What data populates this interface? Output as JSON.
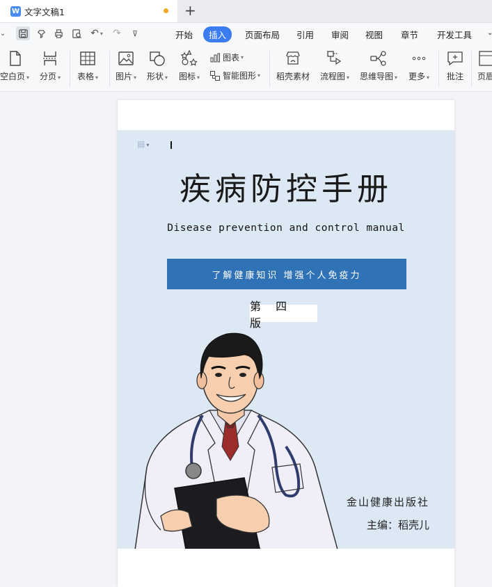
{
  "tab": {
    "title": "文字文稿1"
  },
  "menu": [
    "开始",
    "插入",
    "页面布局",
    "引用",
    "审阅",
    "视图",
    "章节",
    "开发工具"
  ],
  "ribbon": {
    "blank_page": "空白页",
    "page_break": "分页",
    "table": "表格",
    "picture": "图片",
    "shape": "形状",
    "icon": "图标",
    "chart": "图表",
    "smart_art": "智能图形",
    "docer_material": "稻壳素材",
    "flowchart": "流程图",
    "mindmap": "思维导图",
    "more": "更多",
    "comment": "批注",
    "header": "页眉"
  },
  "document": {
    "title": "疾病防控手册",
    "subtitle": "Disease prevention and control manual",
    "banner": "了解健康知识 增强个人免疫力",
    "edition": "第 四 版",
    "publisher": "金山健康出版社",
    "editor": "主编：稻壳儿"
  }
}
